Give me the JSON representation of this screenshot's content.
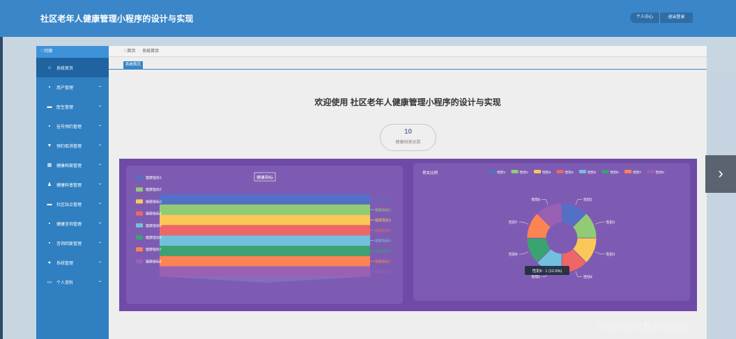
{
  "header": {
    "title": "社区老年人健康管理小程序的设计与实现",
    "personal_center": "个人中心",
    "logout": "退出登录"
  },
  "sidebar": {
    "toggle": "♡切换",
    "items": [
      {
        "icon": "⌂",
        "label": "系统首页",
        "chev": ""
      },
      {
        "icon": "▪",
        "label": "用户管理",
        "chev": "⌄"
      },
      {
        "icon": "▬",
        "label": "医生管理",
        "chev": "⌄"
      },
      {
        "icon": "▪",
        "label": "挂号预约管理",
        "chev": "⌄"
      },
      {
        "icon": "▼",
        "label": "预约取消管理",
        "chev": "⌄"
      },
      {
        "icon": "▦",
        "label": "健康档案管理",
        "chev": "⌄"
      },
      {
        "icon": "♟",
        "label": "健康科普管理",
        "chev": "⌄"
      },
      {
        "icon": "▬",
        "label": "社区站点管理",
        "chev": "⌄"
      },
      {
        "icon": "▪",
        "label": "健康咨询管理",
        "chev": "⌄"
      },
      {
        "icon": "▪",
        "label": "咨询回复管理",
        "chev": "⌄"
      },
      {
        "icon": "●",
        "label": "系统管理",
        "chev": "⌄"
      },
      {
        "icon": "▭",
        "label": "个人资料",
        "chev": "⌄"
      }
    ]
  },
  "breadcrumb": {
    "home": "♡首页",
    "sep": ":",
    "current": "系统首页"
  },
  "tab": {
    "label": "系统首页"
  },
  "main": {
    "welcome": "欢迎使用 社区老年人健康管理小程序的设计与实现"
  },
  "stat": {
    "value": "10",
    "label": "健康档案总数"
  },
  "colors": {
    "c1": "#5470c6",
    "c2": "#91cc75",
    "c3": "#fac858",
    "c4": "#ee6666",
    "c5": "#73c0de",
    "c6": "#3ba272",
    "c7": "#fc8452",
    "c8": "#9a60b4"
  },
  "chart_data": [
    {
      "type": "funnel",
      "title": "健康指标",
      "categories": [
        "健康指标1",
        "健康指标2",
        "健康指标3",
        "健康指标4",
        "健康指标5",
        "健康指标6",
        "健康指标7",
        "健康指标8"
      ]
    },
    {
      "type": "pie",
      "title": "男女比例",
      "categories": [
        "性别1",
        "性别2",
        "性别3",
        "性别4",
        "性别5",
        "性别6",
        "性别7",
        "性别8"
      ],
      "values": [
        1,
        1,
        1,
        1,
        1,
        1,
        1,
        1
      ],
      "tooltip": "性别6 : 1 (12.5%)"
    }
  ],
  "watermark": "CSDN @计算机YiDian",
  "nav_arrow": "›"
}
